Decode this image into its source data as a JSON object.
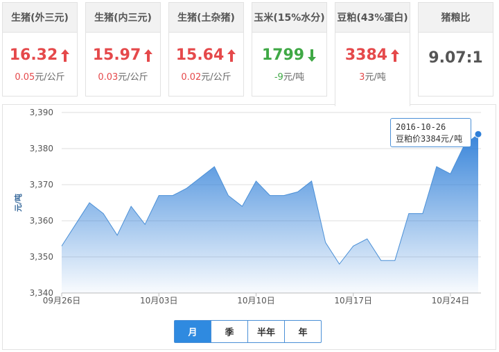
{
  "cards": [
    {
      "title": "生猪(外三元)",
      "price": "16.32",
      "direction": "up",
      "change": "0.05",
      "unit": "元/公斤"
    },
    {
      "title": "生猪(内三元)",
      "price": "15.97",
      "direction": "up",
      "change": "0.03",
      "unit": "元/公斤"
    },
    {
      "title": "生猪(土杂猪)",
      "price": "15.64",
      "direction": "up",
      "change": "0.02",
      "unit": "元/公斤"
    },
    {
      "title": "玉米(15%水分)",
      "price": "1799",
      "direction": "down",
      "change": "-9",
      "unit": "元/吨"
    },
    {
      "title": "豆粕(43%蛋白)",
      "price": "3384",
      "direction": "up",
      "change": "3",
      "unit": "元/吨"
    },
    {
      "title": "猪粮比",
      "price": "9.07:1",
      "direction": "flat",
      "change": "",
      "unit": ""
    }
  ],
  "active_card": 4,
  "tooltip": {
    "date": "2016-10-26",
    "text": "豆粕价3384元/吨"
  },
  "range_buttons": [
    "月",
    "季",
    "半年",
    "年"
  ],
  "active_range": 0,
  "colors": {
    "up": "#e5494b",
    "down": "#3fa845",
    "accent": "#2f8ae0"
  },
  "chart_data": {
    "type": "area",
    "ylabel": "元/吨",
    "ylim": [
      3340,
      3390
    ],
    "yticks": [
      "3,340",
      "3,350",
      "3,360",
      "3,370",
      "3,380",
      "3,390"
    ],
    "xticks": [
      "09月26日",
      "10月03日",
      "10月10日",
      "10月17日",
      "10月24日"
    ],
    "xtick_index": [
      0,
      7,
      14,
      21,
      28
    ],
    "series": [
      {
        "x": [
          "09-26",
          "09-27",
          "09-28",
          "09-29",
          "09-30",
          "10-01",
          "10-02",
          "10-03",
          "10-04",
          "10-05",
          "10-06",
          "10-07",
          "10-08",
          "10-09",
          "10-10",
          "10-11",
          "10-12",
          "10-13",
          "10-14",
          "10-15",
          "10-16",
          "10-17",
          "10-18",
          "10-19",
          "10-20",
          "10-21",
          "10-22",
          "10-23",
          "10-24",
          "10-25",
          "10-26"
        ],
        "values": [
          3353,
          3359,
          3365,
          3362,
          3356,
          3364,
          3359,
          3367,
          3367,
          3369,
          3372,
          3375,
          3367,
          3364,
          3371,
          3367,
          3367,
          3368,
          3371,
          3354,
          3348,
          3353,
          3355,
          3349,
          3349,
          3362,
          3362,
          3375,
          3373,
          3381,
          3384
        ]
      }
    ]
  }
}
